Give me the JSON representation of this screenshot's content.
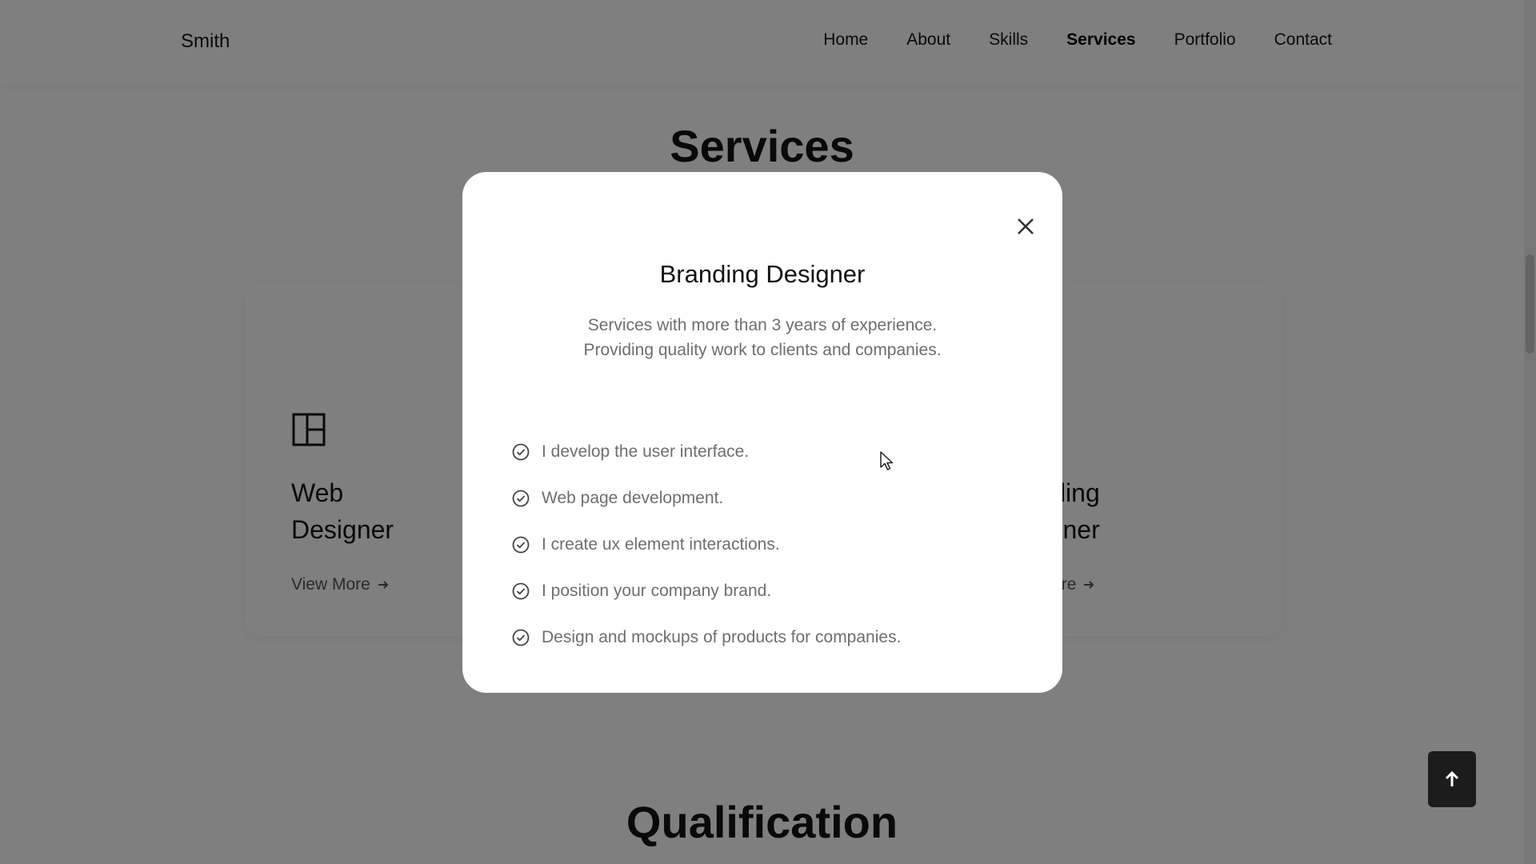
{
  "header": {
    "logo": "Smith",
    "nav": [
      {
        "label": "Home"
      },
      {
        "label": "About"
      },
      {
        "label": "Skills"
      },
      {
        "label": "Services"
      },
      {
        "label": "Portfolio"
      },
      {
        "label": "Contact"
      }
    ],
    "active_nav": "Services"
  },
  "sections": {
    "services_title": "Services",
    "qualification_title": "Qualification"
  },
  "cards": [
    {
      "title": "Web Designer",
      "link": "View More",
      "icon": "layout-icon"
    },
    {
      "title": "",
      "link": "",
      "icon": ""
    },
    {
      "title": "Branding Designer",
      "link": "View More",
      "icon": ""
    }
  ],
  "modal": {
    "title": "Branding Designer",
    "description": "Services with more than 3 years of experience. Providing quality work to clients and companies.",
    "items": [
      "I develop the user interface.",
      "Web page development.",
      "I create ux element interactions.",
      "I position your company brand.",
      "Design and mockups of products for companies."
    ],
    "close_icon": "close-icon",
    "item_icon": "check-circle-icon"
  },
  "colors": {
    "overlay": "rgba(0,0,0,0.5)",
    "text": "#121212",
    "muted": "#6e6e6e",
    "scroll_top_bg": "#1c1c1c"
  }
}
